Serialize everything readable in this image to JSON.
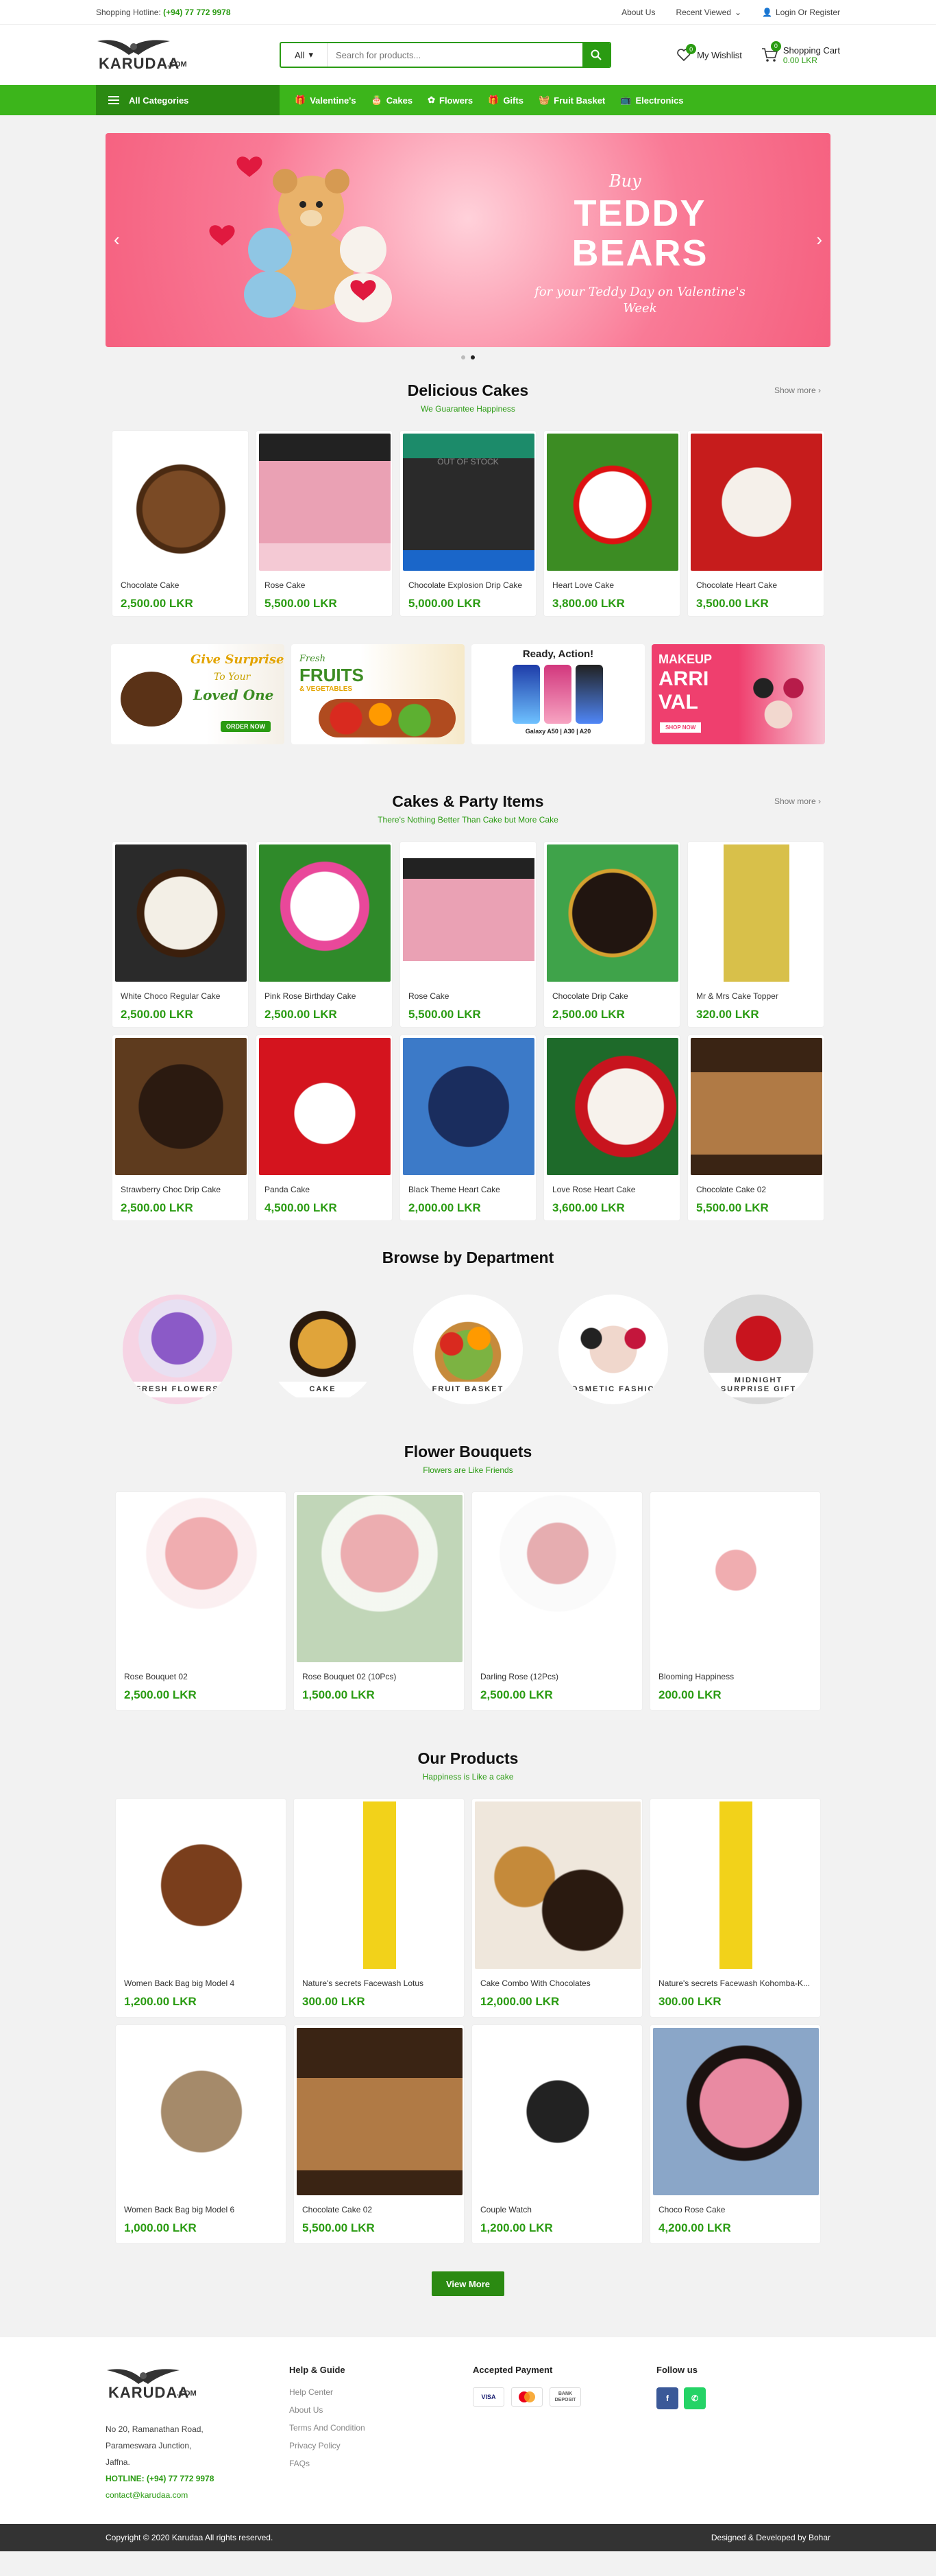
{
  "topbar": {
    "hotline_label": "Shopping Hotline:",
    "hotline_number": "(+94) 77 772 9978",
    "about": "About Us",
    "recent": "Recent Viewed",
    "login": "Login Or Register"
  },
  "header": {
    "logo_text": "KARUDAA",
    "logo_suffix": ".COM",
    "search_category": "All",
    "search_placeholder": "Search for products...",
    "wishlist_label": "My Wishlist",
    "wishlist_count": "0",
    "cart_label": "Shopping Cart",
    "cart_total": "0.00 LKR",
    "cart_count": "0"
  },
  "nav": {
    "all_categories": "All Categories",
    "items": [
      "Valentine's",
      "Cakes",
      "Flowers",
      "Gifts",
      "Fruit Basket",
      "Electronics"
    ]
  },
  "hero": {
    "line1": "Buy",
    "line2a": "TEDDY",
    "line2b": "BEARS",
    "line3": "for your Teddy Day on Valentine's Week"
  },
  "delicious": {
    "title": "Delicious Cakes",
    "subtitle": "We Guarantee Happiness",
    "show_more": "Show more",
    "products": [
      {
        "name": "Chocolate Cake",
        "price": "2,500.00 LKR"
      },
      {
        "name": "Rose Cake",
        "price": "5,500.00 LKR"
      },
      {
        "name": "Chocolate Explosion Drip Cake",
        "price": "5,000.00 LKR"
      },
      {
        "name": "Heart Love Cake",
        "price": "3,800.00 LKR"
      },
      {
        "name": "Chocolate Heart Cake",
        "price": "3,500.00 LKR"
      }
    ]
  },
  "promos": {
    "p1a": "Give Surprise",
    "p1b": "To Your",
    "p1c": "Loved One",
    "p1btn": "ORDER NOW",
    "p2a": "Fresh",
    "p2b": "FRUITS",
    "p2c": "& VEGETABLES",
    "p3a": "Ready, Action!",
    "p3b": "Galaxy A50 | A30 | A20",
    "p4a": "MAKEUP",
    "p4b": "ARRI",
    "p4c": "VAL",
    "p4btn": "SHOP NOW"
  },
  "party": {
    "title": "Cakes & Party Items",
    "subtitle": "There's Nothing Better Than Cake but More Cake",
    "show_more": "Show more",
    "products": [
      {
        "name": "White Choco Regular Cake",
        "price": "2,500.00 LKR"
      },
      {
        "name": "Pink Rose Birthday Cake",
        "price": "2,500.00 LKR"
      },
      {
        "name": "Rose Cake",
        "price": "5,500.00 LKR"
      },
      {
        "name": "Chocolate Drip Cake",
        "price": "2,500.00 LKR"
      },
      {
        "name": "Mr & Mrs Cake Topper",
        "price": "320.00 LKR"
      },
      {
        "name": "Strawberry Choc Drip Cake",
        "price": "2,500.00 LKR"
      },
      {
        "name": "Panda Cake",
        "price": "4,500.00 LKR"
      },
      {
        "name": "Black Theme Heart Cake",
        "price": "2,000.00 LKR"
      },
      {
        "name": "Love Rose Heart Cake",
        "price": "3,600.00 LKR"
      },
      {
        "name": "Chocolate Cake 02",
        "price": "5,500.00 LKR"
      }
    ]
  },
  "departments": {
    "title": "Browse by Department",
    "items": [
      "FRESH FLOWERS",
      "CAKE",
      "FRUIT BASKET",
      "COSMETIC FASHION",
      "MIDNIGHT SURPRISE GIFT"
    ]
  },
  "flowers": {
    "title": "Flower Bouquets",
    "subtitle": "Flowers are Like Friends",
    "out_of_stock": "OUT OF STOCK",
    "products": [
      {
        "name": "Rose Bouquet 02",
        "price": "2,500.00 LKR"
      },
      {
        "name": "Rose Bouquet 02 (10Pcs)",
        "price": "1,500.00 LKR"
      },
      {
        "name": "Darling Rose (12Pcs)",
        "price": "2,500.00 LKR"
      },
      {
        "name": "Blooming Happiness",
        "price": "200.00 LKR"
      }
    ]
  },
  "ourproducts": {
    "title": "Our Products",
    "subtitle": "Happiness is Like a cake",
    "view_more": "View More",
    "products": [
      {
        "name": "Women Back Bag big Model 4",
        "price": "1,200.00 LKR"
      },
      {
        "name": "Nature's secrets Facewash Lotus",
        "price": "300.00 LKR"
      },
      {
        "name": "Cake Combo With Chocolates",
        "price": "12,000.00 LKR"
      },
      {
        "name": "Nature's secrets Facewash Kohomba-K...",
        "price": "300.00 LKR"
      },
      {
        "name": "Women Back Bag big Model 6",
        "price": "1,000.00 LKR"
      },
      {
        "name": "Chocolate Cake 02",
        "price": "5,500.00 LKR"
      },
      {
        "name": "Couple Watch",
        "price": "1,200.00 LKR"
      },
      {
        "name": "Choco Rose Cake",
        "price": "4,200.00 LKR"
      }
    ]
  },
  "footer": {
    "address1": "No 20, Ramanathan Road,",
    "address2": "Parameswara Junction,",
    "address3": "Jaffna.",
    "hotline": "HOTLINE: (+94) 77 772 9978",
    "email": "contact@karudaa.com",
    "help_title": "Help & Guide",
    "help_links": [
      "Help Center",
      "About Us",
      "Terms And Condition",
      "Privacy Policy",
      "FAQs"
    ],
    "payment_title": "Accepted Payment",
    "payments": [
      "VISA",
      "MC",
      "BANK DEPOSIT"
    ],
    "follow_title": "Follow us",
    "copyright": "Copyright © 2020 Karudaa All rights reserved.",
    "developer": "Designed & Developed by Bohar"
  },
  "colors": {
    "accent": "#2a9b12",
    "nav": "#3cb51b",
    "nav_dark": "#2b8a12",
    "hero": "#f5607f"
  }
}
